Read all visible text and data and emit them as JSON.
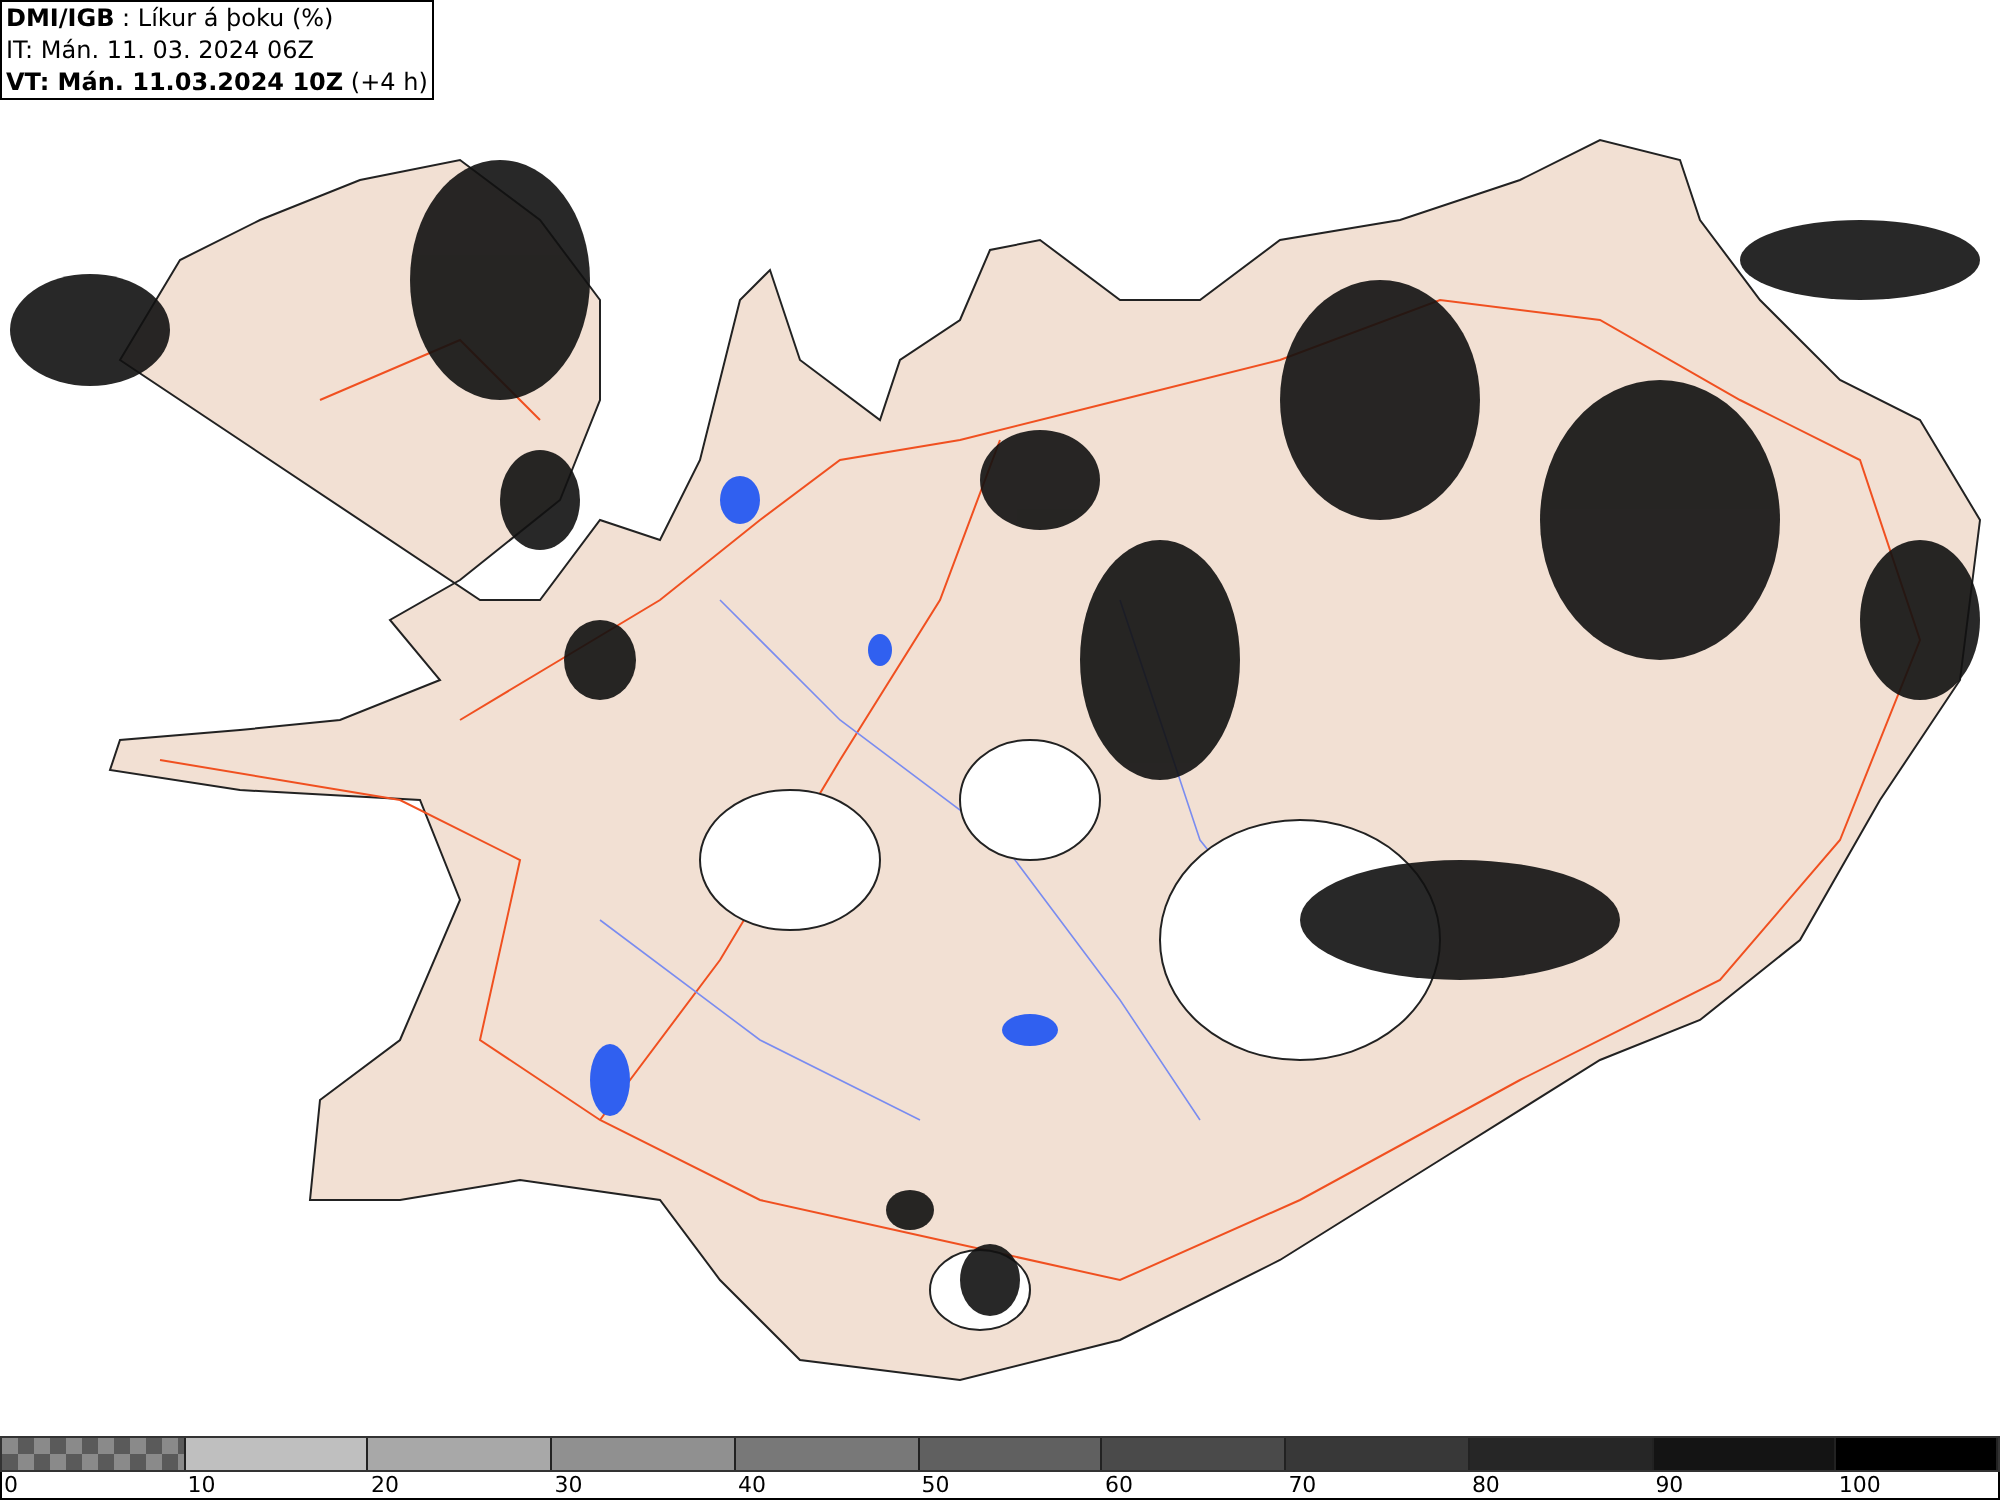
{
  "header": {
    "lines": [
      "**DMI/IGB** : Líkur á þoku (%)",
      "IT: Mán. 11. 03. 2024 06Z",
      "**VT: Mán. 11.03.2024 10Z** (+4 h)"
    ]
  },
  "legend": {
    "segments": [
      {
        "kind": "checker",
        "color": "#5a5a5a"
      },
      {
        "kind": "solid",
        "color": "#bfbfbf"
      },
      {
        "kind": "solid",
        "color": "#a8a8a8"
      },
      {
        "kind": "solid",
        "color": "#909090"
      },
      {
        "kind": "solid",
        "color": "#787878"
      },
      {
        "kind": "solid",
        "color": "#606060"
      },
      {
        "kind": "solid",
        "color": "#4a4a4a"
      },
      {
        "kind": "solid",
        "color": "#383838"
      },
      {
        "kind": "solid",
        "color": "#262626"
      },
      {
        "kind": "solid",
        "color": "#141414"
      },
      {
        "kind": "solid",
        "color": "#000000"
      }
    ],
    "ticks": [
      "0",
      "10",
      "20",
      "30",
      "40",
      "50",
      "60",
      "70",
      "80",
      "90",
      "100"
    ]
  }
}
